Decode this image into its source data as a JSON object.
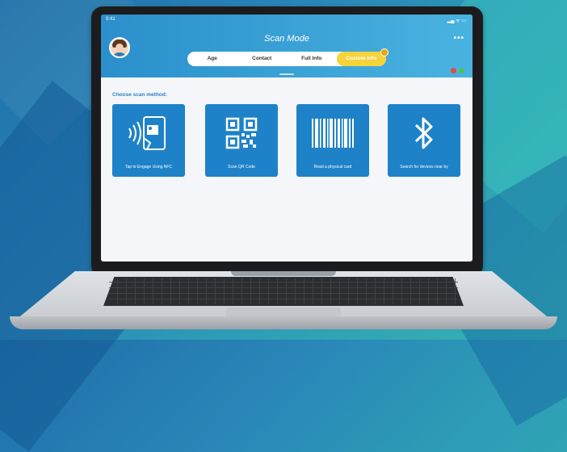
{
  "status": {
    "time": "9:41",
    "icons": "▂▄ ᯤ ▭"
  },
  "header": {
    "title": "Scan Mode",
    "more": "•••"
  },
  "tabs": [
    {
      "label": "Age"
    },
    {
      "label": "Contact"
    },
    {
      "label": "Full Info"
    },
    {
      "label": "Custom Info",
      "active": true,
      "locked": true
    }
  ],
  "main": {
    "choose_label": "Choose scan method:",
    "methods": [
      {
        "label": "Tap to Engage Using NFC",
        "icon": "nfc-phone-icon"
      },
      {
        "label": "Scan QR Code",
        "icon": "qr-code-icon"
      },
      {
        "label": "Read a physical card",
        "icon": "barcode-icon"
      },
      {
        "label": "Search for devices near by",
        "icon": "bluetooth-icon"
      }
    ]
  },
  "colors": {
    "header_start": "#2a8fcb",
    "header_end": "#49b3e0",
    "card": "#1e82c8",
    "active_tab": "#f7d33a",
    "indicator_red": "#e54b3c",
    "indicator_green": "#4cc35a"
  }
}
